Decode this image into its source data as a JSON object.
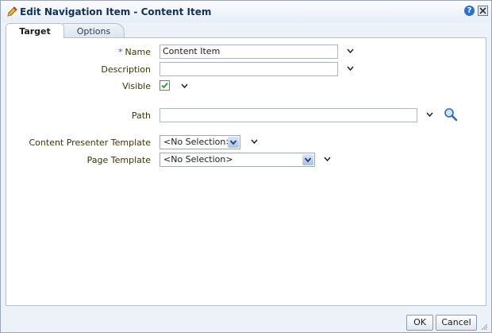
{
  "window": {
    "title": "Edit Navigation Item - Content Item",
    "help_label": "?"
  },
  "tabs": [
    {
      "label": "Target",
      "active": true
    },
    {
      "label": "Options",
      "active": false
    }
  ],
  "form": {
    "name": {
      "required_marker": "*",
      "label": "Name",
      "value": "Content Item"
    },
    "description": {
      "label": "Description",
      "value": ""
    },
    "visible": {
      "label": "Visible",
      "checked": true
    },
    "path": {
      "label": "Path",
      "value": ""
    },
    "content_presenter_template": {
      "label": "Content Presenter Template",
      "selected": "<No Selection>"
    },
    "page_template": {
      "label": "Page Template",
      "selected": "<No Selection>"
    }
  },
  "buttons": {
    "ok": "OK",
    "cancel": "Cancel"
  },
  "colors": {
    "label_text": "#3f3500",
    "title_text": "#10325a",
    "check": "#2b9a2b",
    "required_marker": "#2f5ea8"
  }
}
